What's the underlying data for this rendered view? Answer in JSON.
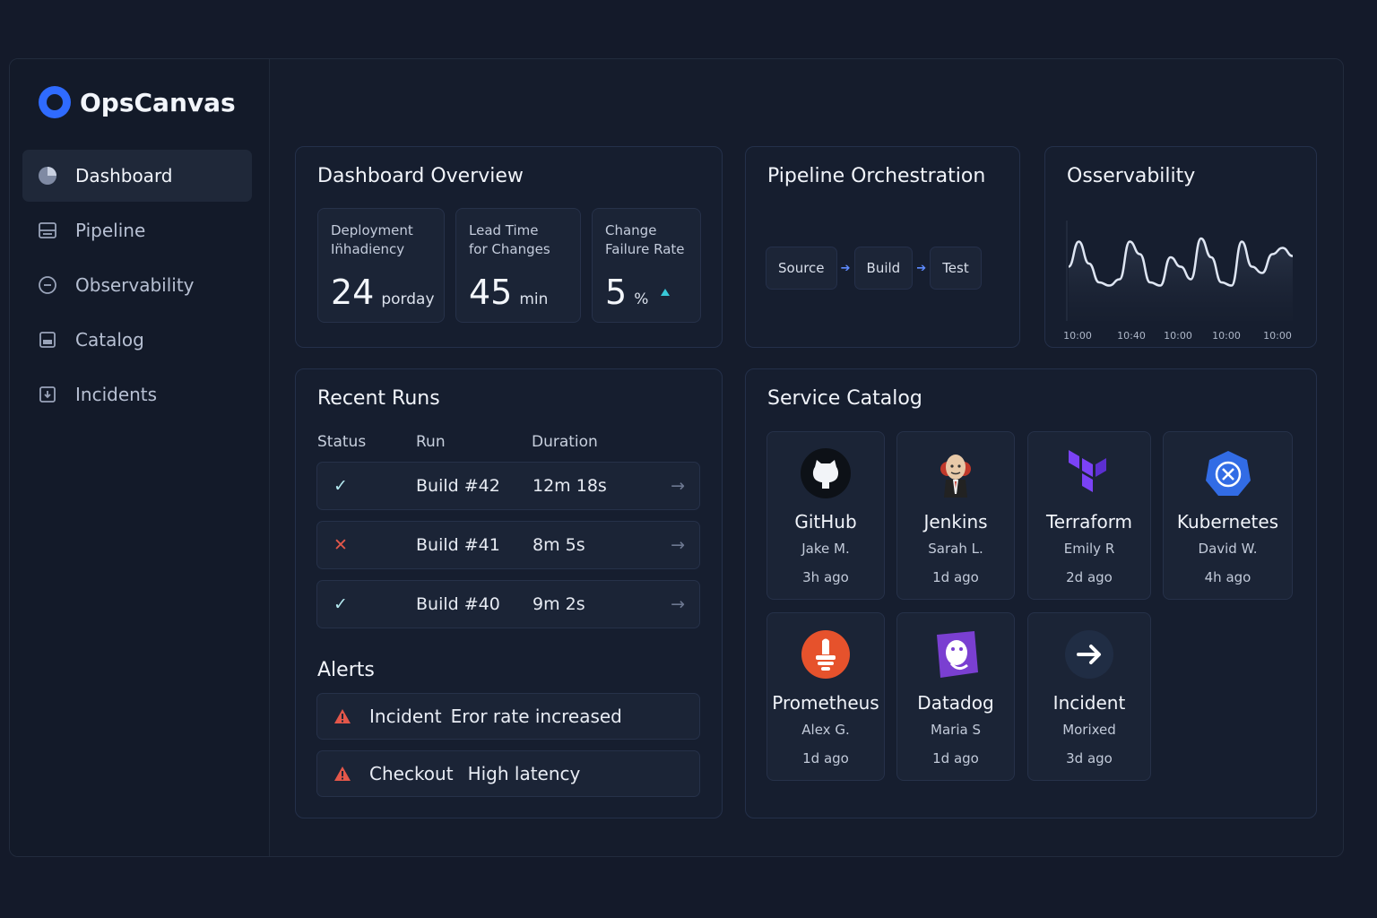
{
  "app": {
    "name": "OpsCanvas"
  },
  "sidebar": {
    "items": [
      {
        "label": "Dashboard",
        "icon": "pie-chart-icon",
        "active": true
      },
      {
        "label": "Pipeline",
        "icon": "pipeline-icon",
        "active": false
      },
      {
        "label": "Observability",
        "icon": "observability-icon",
        "active": false
      },
      {
        "label": "Catalog",
        "icon": "catalog-icon",
        "active": false
      },
      {
        "label": "Incidents",
        "icon": "incidents-icon",
        "active": false
      }
    ]
  },
  "overview": {
    "title": "Dashboard Overview",
    "metrics": [
      {
        "label": "Deployment\nIn̈hadiency",
        "value": "24",
        "unit": "porday"
      },
      {
        "label": "Lead Time\nfor Changes",
        "value": "45",
        "unit": "min"
      },
      {
        "label": "Change\nFailure Rate",
        "value": "5",
        "unit": "%",
        "trend": "up"
      }
    ]
  },
  "pipeline": {
    "title": "Pipeline Orchestration",
    "stages": [
      "Source",
      "Build",
      "Test"
    ]
  },
  "observability": {
    "title": "Osservability",
    "x_ticks": [
      "10:00",
      "10:40",
      "10:00",
      "10:00",
      "10:00"
    ]
  },
  "chart_data": {
    "type": "line",
    "title": "Osservability",
    "x": [
      "10:00",
      "10:40",
      "10:00",
      "10:00",
      "10:00"
    ],
    "y_values": [
      0.55,
      0.95,
      0.6,
      0.3,
      0.25,
      0.35,
      0.95,
      0.75,
      0.3,
      0.25,
      0.7,
      0.55,
      0.35,
      1.0,
      0.7,
      0.3,
      0.25,
      0.95,
      0.55,
      0.45,
      0.75,
      0.85,
      0.72
    ],
    "grid": false,
    "color": "#dfe6f3"
  },
  "runs": {
    "title": "Recent Runs",
    "columns": [
      "Status",
      "Run",
      "Duration"
    ],
    "rows": [
      {
        "status": "success",
        "run": "Build #42",
        "duration": "12m 18s"
      },
      {
        "status": "failed",
        "run": "Build #41",
        "duration": "8m 5s"
      },
      {
        "status": "success",
        "run": "Build #40",
        "duration": "9m 2s"
      }
    ]
  },
  "alerts": {
    "title": "Alerts",
    "items": [
      {
        "service": "Incident",
        "message": "Eror rate increased"
      },
      {
        "service": "Checkout",
        "message": "High latency"
      }
    ]
  },
  "catalog": {
    "title": "Service Catalog",
    "services": [
      {
        "name": "GitHub",
        "owner": "Jake M.",
        "time": "3h ago",
        "icon": "github-icon"
      },
      {
        "name": "Jenkins",
        "owner": "Sarah L.",
        "time": "1d ago",
        "icon": "jenkins-icon"
      },
      {
        "name": "Terraform",
        "owner": "Emily R",
        "time": "2d ago",
        "icon": "terraform-icon"
      },
      {
        "name": "Kubernetes",
        "owner": "David W.",
        "time": "4h ago",
        "icon": "kubernetes-icon"
      },
      {
        "name": "Prometheus",
        "owner": "Alex G.",
        "time": "1d ago",
        "icon": "prometheus-icon"
      },
      {
        "name": "Datadog",
        "owner": "Maria S",
        "time": "1d ago",
        "icon": "datadog-icon"
      },
      {
        "name": "Incident",
        "owner": "Morixed",
        "time": "3d ago",
        "icon": "incident-arrow-icon"
      }
    ]
  },
  "colors": {
    "accent": "#2f6bff",
    "success": "#b4e9f0",
    "error": "#e3574a",
    "background": "#141a2a"
  }
}
